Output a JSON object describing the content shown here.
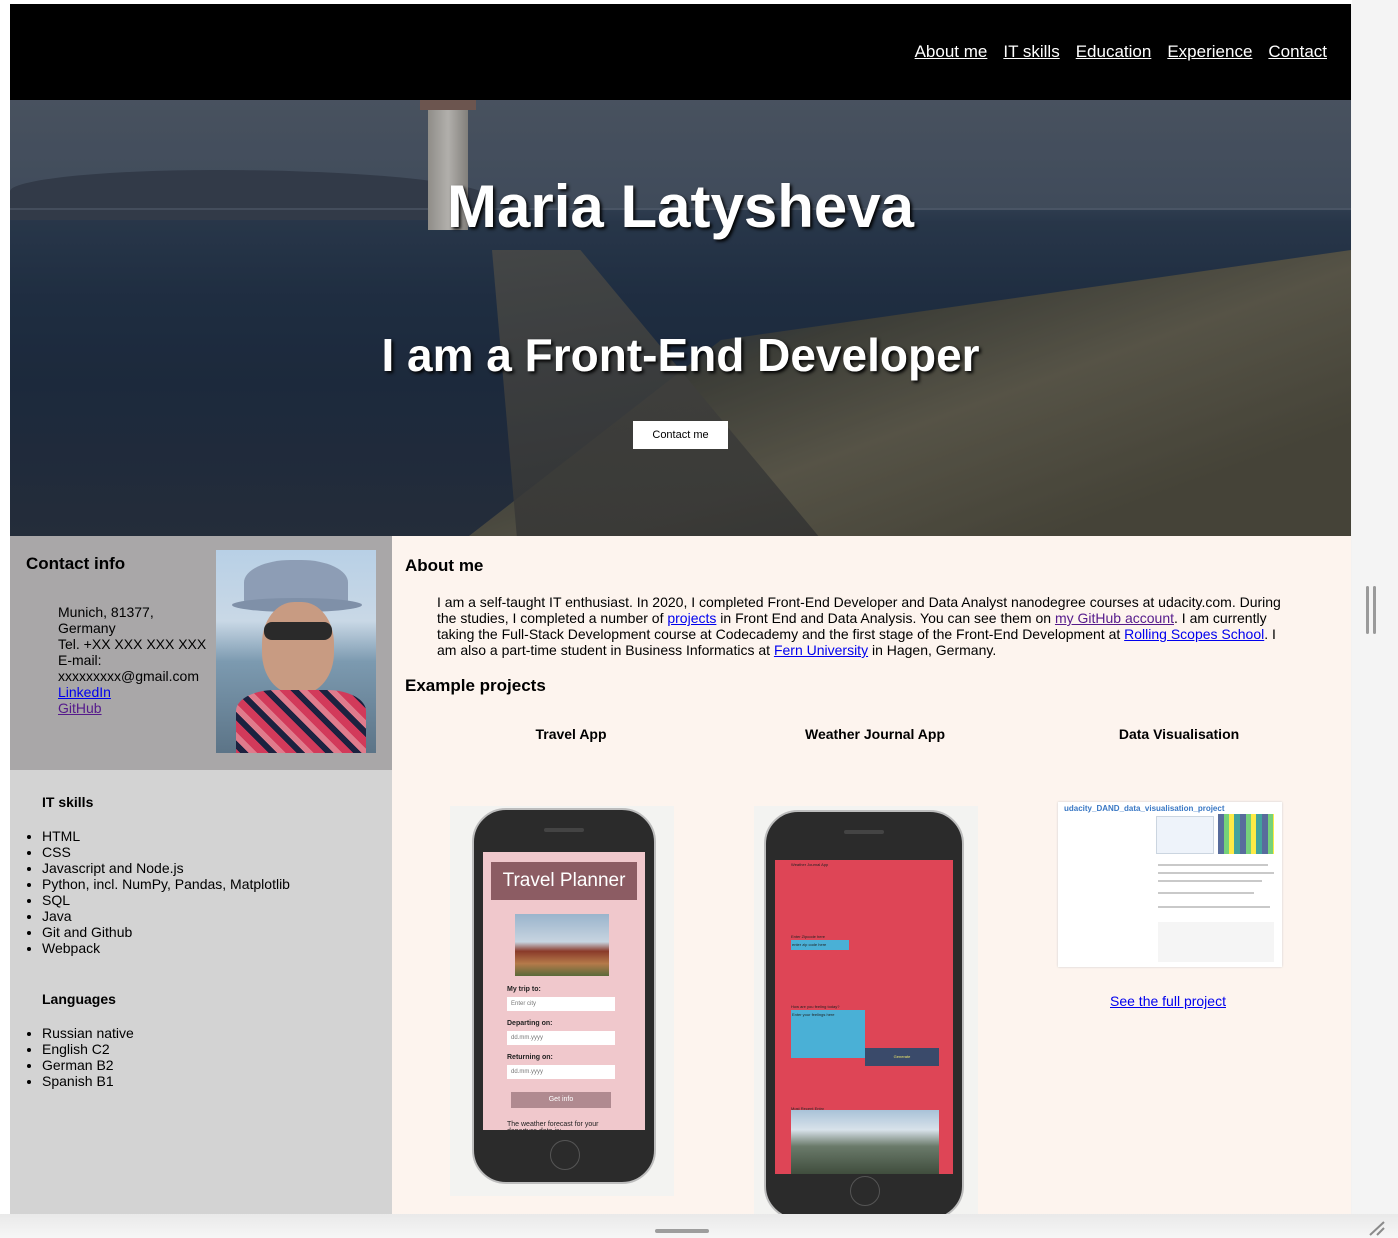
{
  "nav": {
    "items": [
      {
        "label": "About me"
      },
      {
        "label": "IT skills"
      },
      {
        "label": "Education"
      },
      {
        "label": "Experience"
      },
      {
        "label": "Contact"
      }
    ]
  },
  "hero": {
    "name": "Maria Latysheva",
    "subtitle": "I am a Front-End Developer",
    "cta_label": "Contact me"
  },
  "contact": {
    "heading": "Contact info",
    "address_line1": "Munich, 81377,",
    "address_line2": "Germany",
    "phone": "Tel. +XX XXX XXX XXX",
    "email_label": "E-mail:",
    "email": "xxxxxxxxx@gmail.com",
    "linkedin": "LinkedIn",
    "github": "GitHub"
  },
  "skills": {
    "heading": "IT skills",
    "items": [
      "HTML",
      "CSS",
      "Javascript and Node.js",
      "Python, incl. NumPy, Pandas, Matplotlib",
      "SQL",
      "Java",
      "Git and Github",
      "Webpack"
    ]
  },
  "languages": {
    "heading": "Languages",
    "items": [
      "Russian native",
      "English C2",
      "German B2",
      "Spanish B1"
    ]
  },
  "about": {
    "heading": "About me",
    "t1": "I am a self-taught IT enthusiast. In 2020, I completed Front-End Developer and Data Analyst nanodegree courses at udacity.com. During the studies, I completed a number of ",
    "link_projects": "projects",
    "t2": " in Front End and Data Analysis. You can see them on ",
    "link_github": "my GitHub account",
    "t3": ". I am currently taking the Full-Stack Development course at Codecademy and the first stage of the Front-End Development at ",
    "link_rss": "Rolling Scopes School",
    "t4": ". I am also a part-time student in Business Informatics at ",
    "link_fern": "Fern University",
    "t5": " in Hagen, Germany."
  },
  "projects": {
    "heading": "Example projects",
    "items": [
      {
        "title": "Travel App"
      },
      {
        "title": "Weather Journal App"
      },
      {
        "title": "Data Visualisation"
      }
    ],
    "see_full": "See the full project"
  },
  "travel_mock": {
    "banner": "Travel Planner",
    "trip_label": "My trip to:",
    "city_placeholder": "Enter city",
    "departing_label": "Departing on:",
    "date_placeholder": "dd.mm.yyyy",
    "returning_label": "Returning on:",
    "button": "Get info",
    "forecast": "The weather forecast for your departure date is:"
  },
  "weather_mock": {
    "header": "Weather Journal App",
    "zip_label": "Enter Zipcode here",
    "zip_placeholder": "enter zip code here",
    "feel_label": "How are you feeling today?",
    "feel_placeholder": "Enter your feelings here",
    "generate": "Generate",
    "recent": "Most Recent Entry"
  },
  "dataviz_mock": {
    "title": "udacity_DAND_data_visualisation_project"
  }
}
